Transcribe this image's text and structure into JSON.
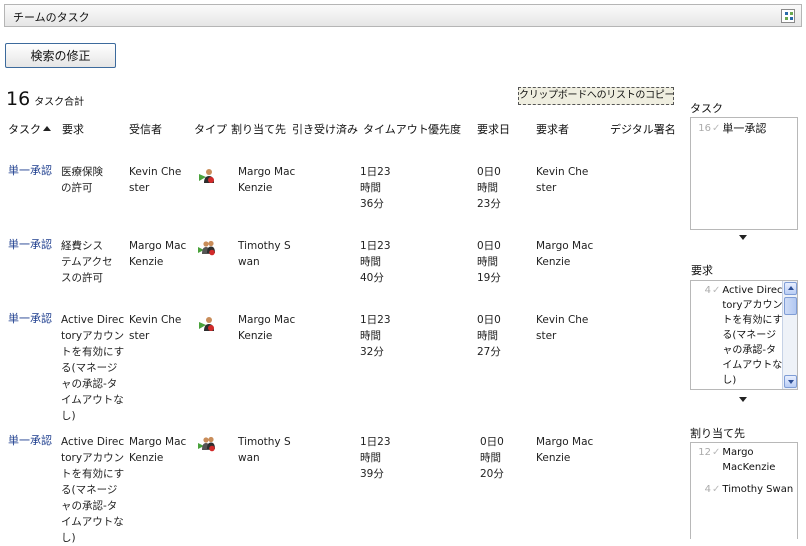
{
  "header": {
    "title": "チームのタスク",
    "menu_icon": "grid-menu-icon"
  },
  "toolbar": {
    "modify_search_label": "検索の修正",
    "copy_list_label": "クリップボードへのリストのコピー"
  },
  "summary": {
    "count": "16",
    "label": "タスク合計"
  },
  "columns": {
    "task": "タスク",
    "request": "要求",
    "recipient": "受信者",
    "type": "タイプ",
    "assigned_to": "割り当て先",
    "claimed": "引き受け済み",
    "timeout": "タイムアウト",
    "priority": "優先度",
    "request_date": "要求日",
    "requester": "要求者",
    "digital_signature": "デジタル署名"
  },
  "rows": [
    {
      "task": "単一承認",
      "request": "医療保険の許可",
      "recipient": "Kevin Chester",
      "type_icon": "single-user-icon",
      "assigned_to": "Margo MacKenzie",
      "timeout": [
        "1日23",
        "時間",
        "36分"
      ],
      "request_date": [
        "0日0",
        "時間",
        "23分"
      ],
      "requester": "Kevin Chester"
    },
    {
      "task": "単一承認",
      "request": "経費システムアクセスの許可",
      "recipient": "Margo MacKenzie",
      "type_icon": "group-icon",
      "assigned_to": "Timothy Swan",
      "timeout": [
        "1日23",
        "時間",
        "40分"
      ],
      "request_date": [
        "0日0",
        "時間",
        "19分"
      ],
      "requester": "Margo MacKenzie"
    },
    {
      "task": "単一承認",
      "request": "Active Directoryアカウントを有効にする(マネージャの承認-タイムアウトなし)",
      "recipient": "Kevin Chester",
      "type_icon": "single-user-icon",
      "assigned_to": "Margo MacKenzie",
      "timeout": [
        "1日23",
        "時間",
        "32分"
      ],
      "request_date": [
        "0日0",
        "時間",
        "27分"
      ],
      "requester": "Kevin Chester"
    },
    {
      "task": "単一承認",
      "request": "Active Directoryアカウントを有効にする(マネージャの承認-タイムアウトなし)",
      "recipient": "Margo MacKenzie",
      "type_icon": "group-icon",
      "assigned_to": "Timothy Swan",
      "timeout": [
        "1日23",
        "時間",
        "39分"
      ],
      "request_date": [
        "0日0",
        "時間",
        "20分"
      ],
      "requester": "Margo MacKenzie"
    }
  ],
  "sidebar": {
    "tasks": {
      "title": "タスク",
      "items": [
        {
          "count": "16",
          "label": "単一承認"
        }
      ]
    },
    "requests": {
      "title": "要求",
      "items": [
        {
          "count": "4",
          "label": "Active Directoryアカウントを有効にする(マネージャの承認-タイムアウトなし)"
        }
      ]
    },
    "assignees": {
      "title": "割り当て先",
      "items": [
        {
          "count": "12",
          "label": "Margo MacKenzie"
        },
        {
          "count": "4",
          "label": "Timothy Swan"
        }
      ]
    }
  }
}
